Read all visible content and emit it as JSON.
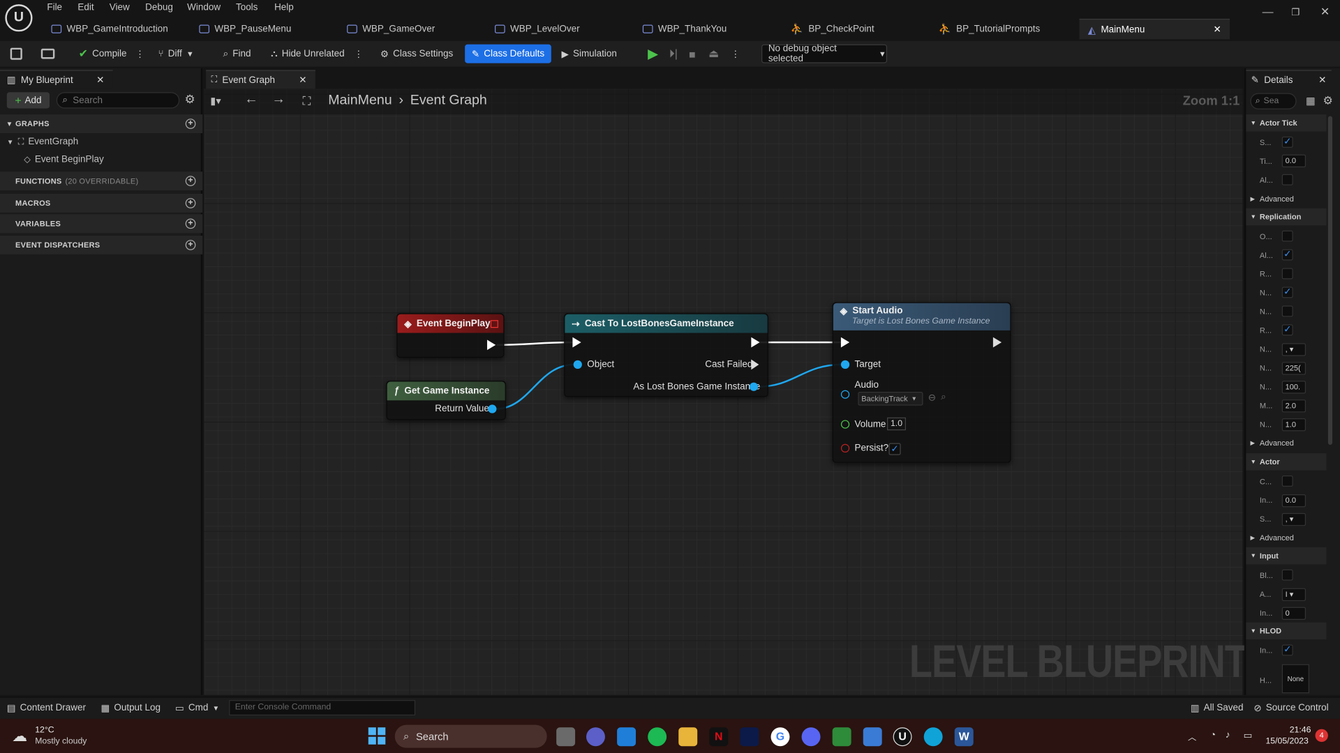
{
  "menus": [
    "File",
    "Edit",
    "View",
    "Debug",
    "Window",
    "Tools",
    "Help"
  ],
  "doc_tabs": [
    "WBP_GameIntroduction",
    "WBP_PauseMenu",
    "WBP_GameOver",
    "WBP_LevelOver",
    "WBP_ThankYou",
    "BP_CheckPoint",
    "BP_TutorialPrompts",
    "MainMenu"
  ],
  "toolbar": {
    "compile": "Compile",
    "diff": "Diff",
    "find": "Find",
    "hide_unrelated": "Hide Unrelated",
    "class_settings": "Class Settings",
    "class_defaults": "Class Defaults",
    "simulation": "Simulation",
    "debug_object": "No debug object selected"
  },
  "my_blueprint": {
    "tab": "My Blueprint",
    "add": "Add",
    "search_placeholder": "Search",
    "graphs": "GRAPHS",
    "event_graph": "EventGraph",
    "begin_play": "Event BeginPlay",
    "functions": "FUNCTIONS",
    "functions_count": "(20 OVERRIDABLE)",
    "macros": "MACROS",
    "variables": "VARIABLES",
    "dispatchers": "EVENT DISPATCHERS"
  },
  "graph": {
    "tab": "Event Graph",
    "crumb_root": "MainMenu",
    "crumb_leaf": "Event Graph",
    "zoom": "Zoom 1:1",
    "watermark": "LEVEL BLUEPRINT"
  },
  "nodes": {
    "begin_play": {
      "title": "Event BeginPlay"
    },
    "game_instance": {
      "title": "Get Game Instance",
      "ret": "Return Value"
    },
    "cast": {
      "title": "Cast To LostBonesGameInstance",
      "object": "Object",
      "failed": "Cast Failed",
      "as": "As Lost Bones Game Instance"
    },
    "start_audio": {
      "title": "Start Audio",
      "subtitle": "Target is Lost Bones Game Instance",
      "target": "Target",
      "audio": "Audio",
      "audio_value": "BackingTrack",
      "volume": "Volume",
      "volume_value": "1.0",
      "persist": "Persist?"
    }
  },
  "details": {
    "tab": "Details",
    "search_placeholder": "Sea",
    "sections": [
      {
        "title": "Actor Tick",
        "rows": [
          {
            "label": "S...",
            "check": true
          },
          {
            "label": "Ti...",
            "value": "0.0"
          },
          {
            "label": "Al...",
            "check": false
          }
        ],
        "advanced": "Advanced"
      },
      {
        "title": "Replication",
        "rows": [
          {
            "label": "O...",
            "check": false
          },
          {
            "label": "Al...",
            "check": true
          },
          {
            "label": "R...",
            "check": false
          },
          {
            "label": "N...",
            "check": true
          },
          {
            "label": "N...",
            "check": false
          },
          {
            "label": "R...",
            "check": true
          },
          {
            "label": "N...",
            "value": ", ▾"
          },
          {
            "label": "N...",
            "value": "225("
          },
          {
            "label": "N...",
            "value": "100."
          },
          {
            "label": "M...",
            "value": "2.0"
          },
          {
            "label": "N...",
            "value": "1.0"
          }
        ],
        "advanced": "Advanced"
      },
      {
        "title": "Actor",
        "rows": [
          {
            "label": "C...",
            "check": false
          },
          {
            "label": "In...",
            "value": "0.0"
          },
          {
            "label": "S...",
            "value": ", ▾"
          }
        ],
        "advanced": "Advanced"
      },
      {
        "title": "Input",
        "rows": [
          {
            "label": "Bl...",
            "check": false
          },
          {
            "label": "A...",
            "value": "I ▾"
          },
          {
            "label": "In...",
            "value": "0"
          }
        ]
      },
      {
        "title": "HLOD",
        "rows": [
          {
            "label": "In...",
            "check": true
          },
          {
            "label": "H...",
            "value": "None"
          }
        ]
      }
    ]
  },
  "bottom": {
    "content_drawer": "Content Drawer",
    "output_log": "Output Log",
    "cmd": "Cmd",
    "console_placeholder": "Enter Console Command",
    "all_saved": "All Saved",
    "source_control": "Source Control"
  },
  "taskbar": {
    "temp": "12°C",
    "weather": "Mostly cloudy",
    "search": "Search",
    "time": "21:46",
    "date": "15/05/2023",
    "badge": "4"
  },
  "colors": {
    "accent": "#1d6fe6",
    "event_head": "#8a1a1a",
    "pure_head": "#39503a",
    "cast_head": "#1d5a63",
    "call_head": "#3a5a77",
    "exec_wire": "#ffffff",
    "object_wire": "#1fa8f0"
  }
}
